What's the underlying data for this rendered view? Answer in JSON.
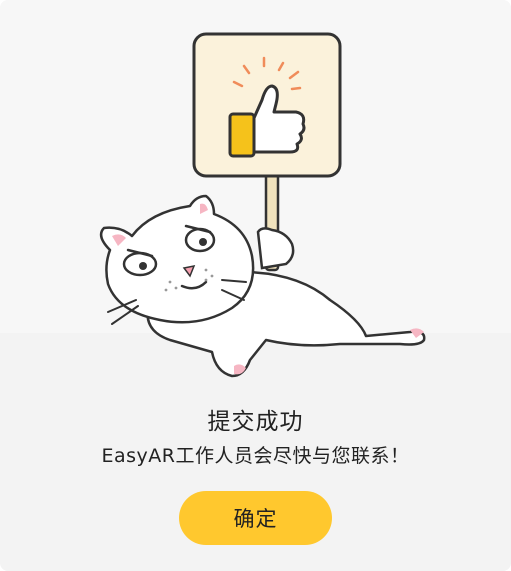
{
  "dialog": {
    "title": "提交成功",
    "message": "EasyAR工作人员会尽快与您联系！",
    "confirm_label": "确定"
  },
  "illustration": {
    "icon": "cat-holding-thumbs-up-sign-illustration"
  },
  "colors": {
    "accent": "#ffc82e",
    "background": "#f3f3f3",
    "text": "#222222"
  }
}
